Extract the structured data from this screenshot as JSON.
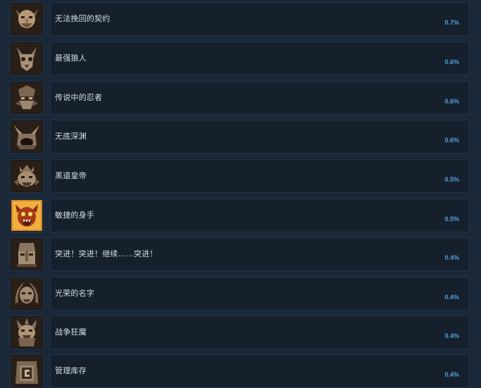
{
  "achievements": [
    {
      "name": "无法挽回的契约",
      "percent": "0.7%",
      "icon": "dwarf-face-icon",
      "icon_color": "#b89a78"
    },
    {
      "name": "最强狼人",
      "percent": "0.6%",
      "icon": "wolf-skull-icon",
      "icon_color": "#a8907a"
    },
    {
      "name": "传说中的忍者",
      "percent": "0.6%",
      "icon": "ninja-mask-icon",
      "icon_color": "#9c8870"
    },
    {
      "name": "无底深渊",
      "percent": "0.6%",
      "icon": "abyss-horns-icon",
      "icon_color": "#a38a70"
    },
    {
      "name": "黑道皇帝",
      "percent": "0.5%",
      "icon": "emperor-crown-icon",
      "icon_color": "#a88f74"
    },
    {
      "name": "敏捷的身手",
      "percent": "0.5%",
      "icon": "golden-demon-icon",
      "icon_color": "#d88a2a"
    },
    {
      "name": "突进！突进！继续……突进！",
      "percent": "0.4%",
      "icon": "warrior-helmet-icon",
      "icon_color": "#a38c72"
    },
    {
      "name": "光荣的名字",
      "percent": "0.4%",
      "icon": "laurel-face-icon",
      "icon_color": "#a08a70"
    },
    {
      "name": "战争狂魔",
      "percent": "0.4%",
      "icon": "war-demon-icon",
      "icon_color": "#b09478"
    },
    {
      "name": "管理库存",
      "percent": "0.4%",
      "icon": "inventory-chest-icon",
      "icon_color": "#9a8670"
    }
  ]
}
